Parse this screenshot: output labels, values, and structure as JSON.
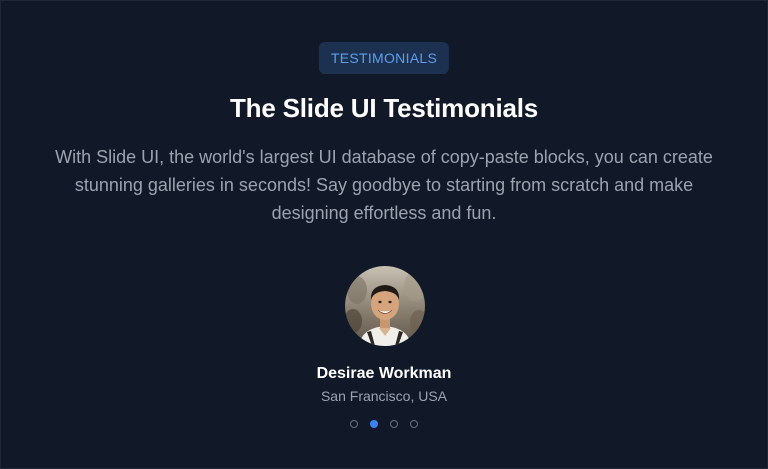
{
  "section": {
    "badge": "TESTIMONIALS",
    "title": "The Slide UI Testimonials",
    "description": "With Slide UI, the world's largest UI database of copy-paste blocks, you can create stunning galleries in seconds! Say goodbye to starting from scratch and make designing effortless and fun."
  },
  "testimonial": {
    "name": "Desirae Workman",
    "location": "San Francisco, USA",
    "avatar_icon": "person-photo"
  },
  "pagination": {
    "count": 4,
    "active_index": 1,
    "active_color": "#3b82f6",
    "inactive_color": "#6b7280"
  },
  "colors": {
    "background": "#111827",
    "accent": "#3b82f6",
    "badge_background": "#1c3150",
    "badge_text": "#5b9ef0"
  }
}
